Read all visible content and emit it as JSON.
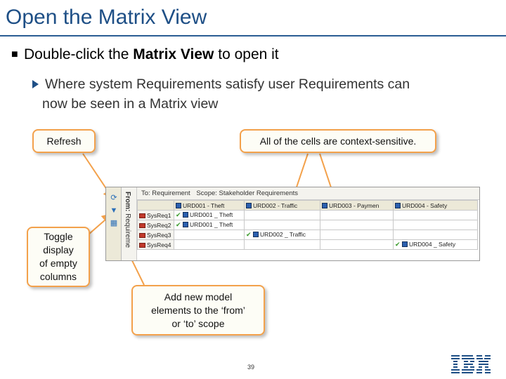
{
  "slide": {
    "title": "Open the Matrix View",
    "bullet_prefix": "Double-click the ",
    "bullet_bold": "Matrix View",
    "bullet_suffix": " to open it",
    "sub_bullet_line1": "Where system Requirements satisfy user Requirements can",
    "sub_bullet_line2": "now be seen in a Matrix view",
    "page_number": "39"
  },
  "callouts": {
    "refresh": "Refresh",
    "context": "All of the cells are context-sensitive.",
    "toggle_line1": "Toggle",
    "toggle_line2": "display",
    "toggle_line3": "of empty",
    "toggle_line4": "columns",
    "add_line1": "Add new model",
    "add_line2": "elements to the ‘from’",
    "add_line3": "or ‘to’ scope"
  },
  "matrix": {
    "to_label": "To: Requirement",
    "scope_label": "Scope: Stakeholder Requirements",
    "from_label_bold": "From:",
    "from_label_rest": " Requireme",
    "columns": [
      "URD001 - Theft",
      "URD002 - Traffic",
      "URD003 - Paymen",
      "URD004 - Safety"
    ],
    "rows": [
      {
        "name": "SysReq1",
        "cells": [
          "URD001 _ Theft",
          "",
          "",
          ""
        ]
      },
      {
        "name": "SysReq2",
        "cells": [
          "URD001 _ Theft",
          "",
          "",
          ""
        ]
      },
      {
        "name": "SysReq3",
        "cells": [
          "",
          "URD002 _ Traffic",
          "",
          ""
        ]
      },
      {
        "name": "SysReq4",
        "cells": [
          "",
          "",
          "",
          "URD004 _ Safety"
        ]
      }
    ]
  },
  "icons": {
    "refresh": "refresh-icon",
    "filter": "filter-icon",
    "scope": "scope-icon",
    "logo": "ibm-logo"
  },
  "colors": {
    "title": "#1e4f86",
    "callout_border": "#f3a14b",
    "arrow": "#f3a14b"
  }
}
